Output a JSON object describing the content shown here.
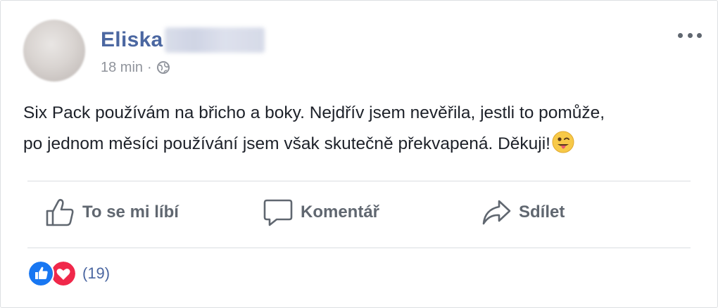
{
  "post": {
    "author_name": "Eliska",
    "timestamp": "18 min",
    "separator": "·",
    "privacy_icon": "globe-icon",
    "menu_icon": "more-options-icon",
    "text_line_1": "Six Pack používám na břicho a boky. Nejdřív jsem nevěřila, jestli to pomůže,",
    "text_line_2": "po jednom měsíci používání jsem však skutečně překvapená. Děkuji!",
    "emoji": "tongue-out-emoji"
  },
  "actions": {
    "like_label": "To se mi líbí",
    "comment_label": "Komentář",
    "share_label": "Sdílet"
  },
  "reactions": {
    "icons": [
      "like-reaction-icon",
      "love-reaction-icon"
    ],
    "count": "(19)"
  },
  "colors": {
    "name_blue": "#4b67a1",
    "text": "#1d2129",
    "muted": "#90949c",
    "action_gray": "#606770",
    "like_blue": "#1877f2",
    "love_red": "#f0284a"
  }
}
